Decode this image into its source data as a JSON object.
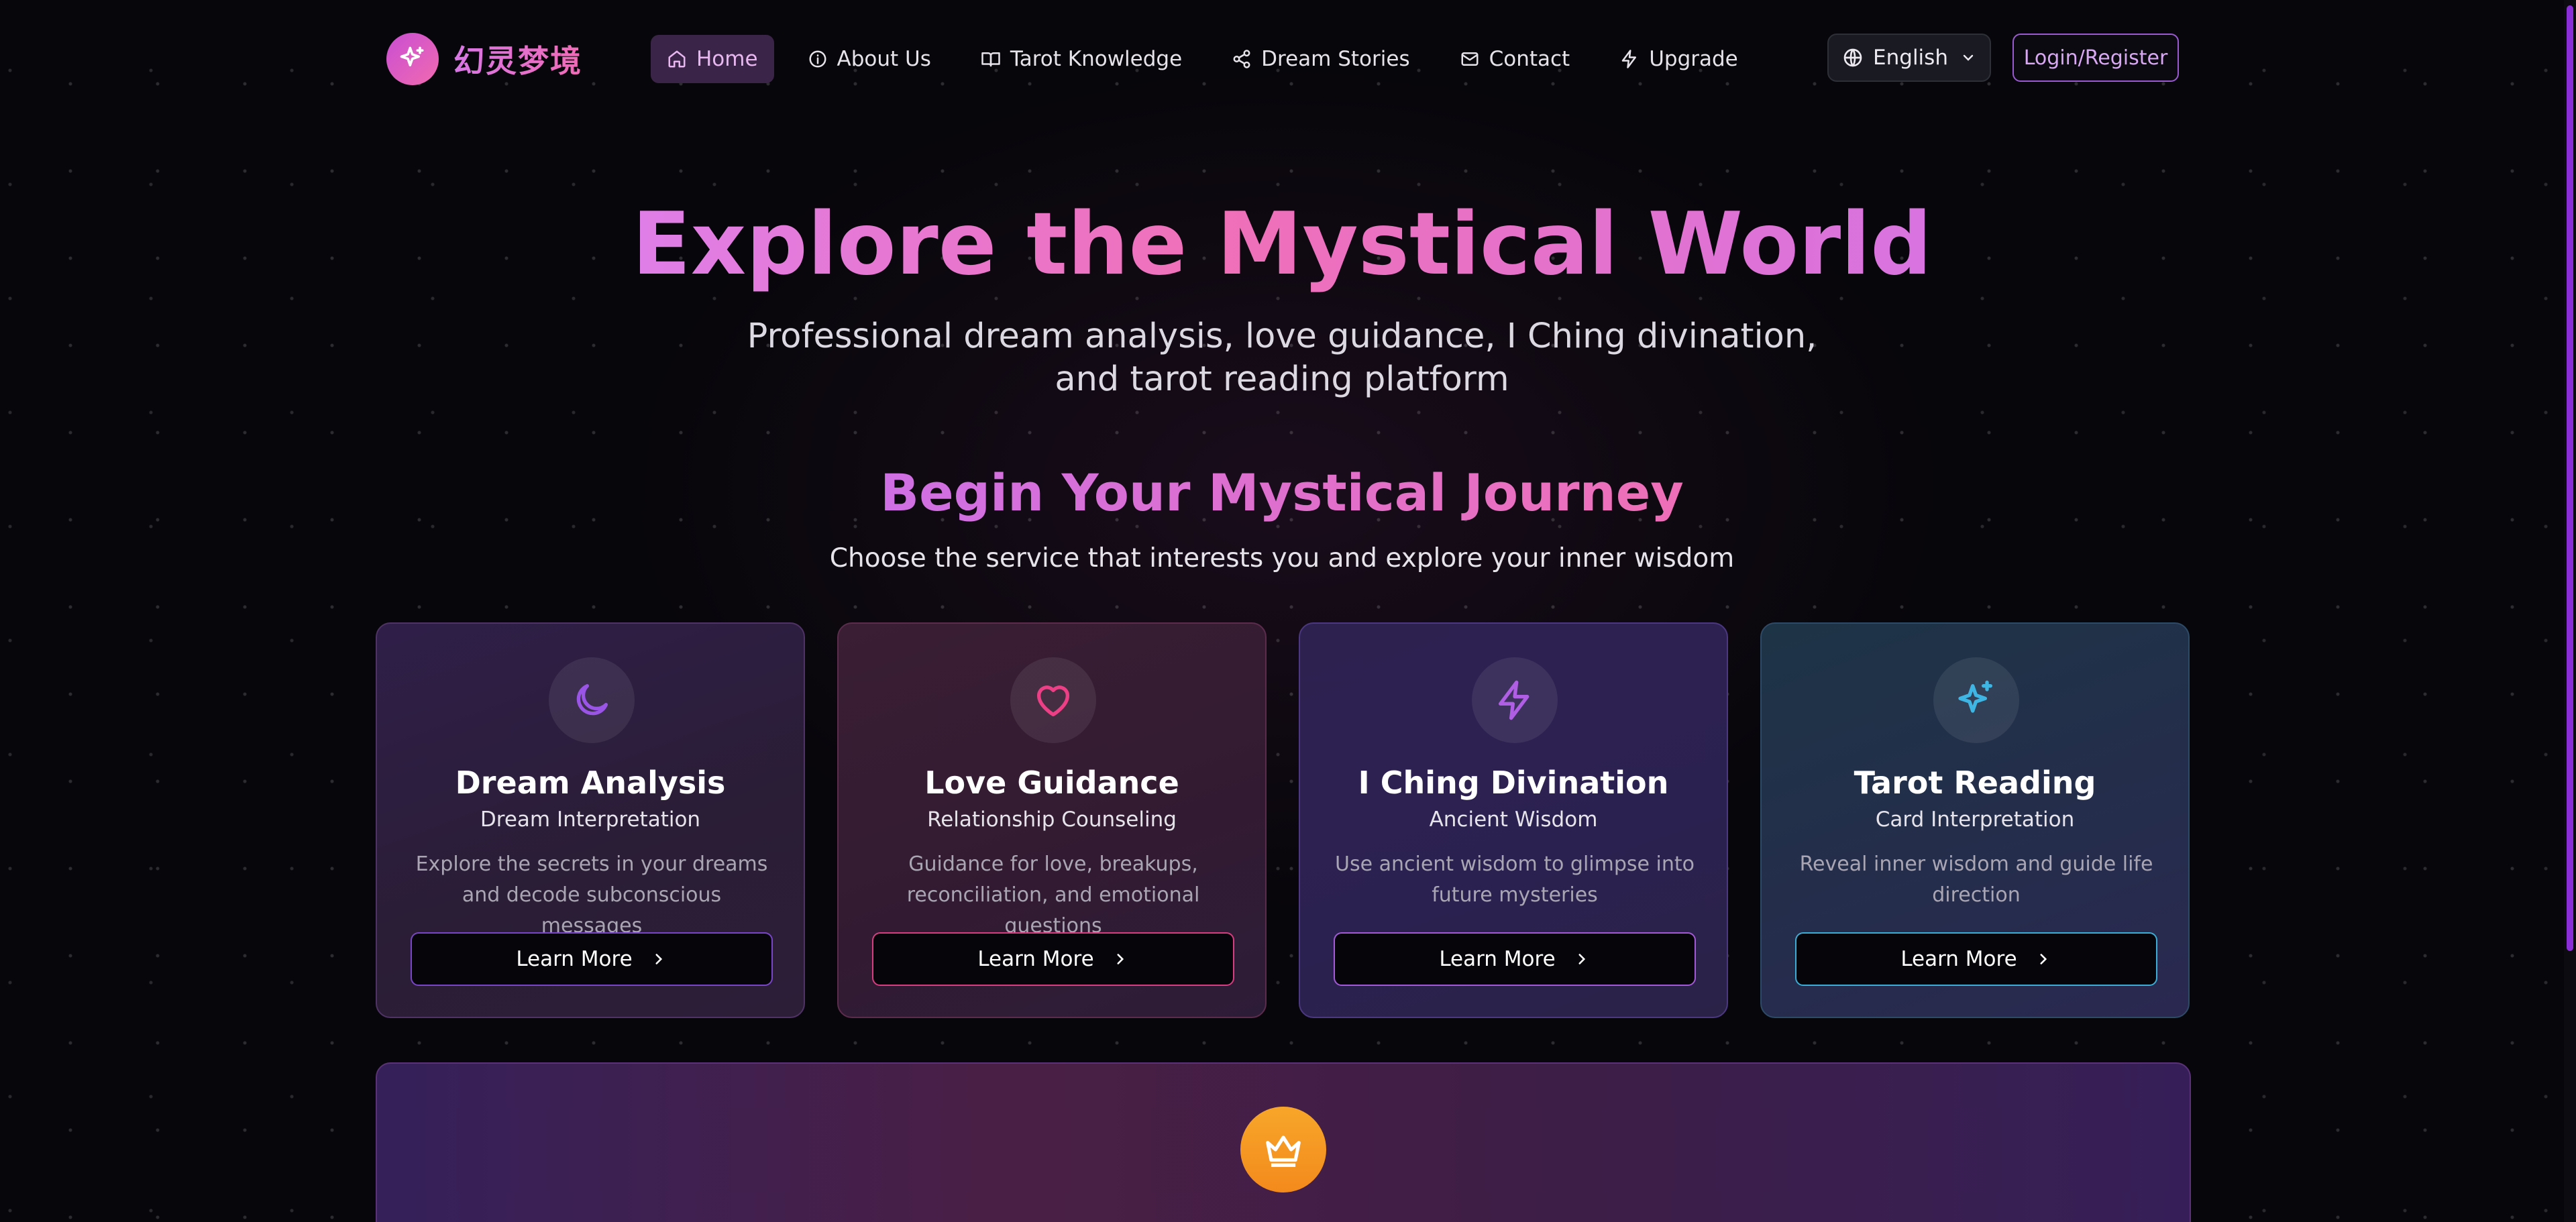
{
  "brand": {
    "name": "幻灵梦境"
  },
  "nav": {
    "items": [
      {
        "label": "Home",
        "icon": "home-icon",
        "active": true
      },
      {
        "label": "About Us",
        "icon": "info-icon",
        "active": false
      },
      {
        "label": "Tarot Knowledge",
        "icon": "book-icon",
        "active": false
      },
      {
        "label": "Dream Stories",
        "icon": "share-icon",
        "active": false
      },
      {
        "label": "Contact",
        "icon": "mail-icon",
        "active": false
      },
      {
        "label": "Upgrade",
        "icon": "lightning-icon",
        "active": false
      }
    ],
    "language": "English",
    "login_label": "Login/Register"
  },
  "hero": {
    "title": "Explore the Mystical World",
    "subtitle": "Professional dream analysis, love guidance, I Ching divination, and tarot reading platform"
  },
  "journey": {
    "title": "Begin Your Mystical Journey",
    "subtitle": "Choose the service that interests you and explore your inner wisdom"
  },
  "cards": [
    {
      "title": "Dream Analysis",
      "subtitle": "Dream Interpretation",
      "description": "Explore the secrets in your dreams and decode subconscious messages",
      "button": "Learn More",
      "icon": "moon-icon",
      "accent": "#9b55e6"
    },
    {
      "title": "Love Guidance",
      "subtitle": "Relationship Counseling",
      "description": "Guidance for love, breakups, reconciliation, and emotional questions",
      "button": "Learn More",
      "icon": "heart-icon",
      "accent": "#ec3f86"
    },
    {
      "title": "I Ching Divination",
      "subtitle": "Ancient Wisdom",
      "description": "Use ancient wisdom to glimpse into future mysteries",
      "button": "Learn More",
      "icon": "lightning-icon",
      "accent": "#b05ee4"
    },
    {
      "title": "Tarot Reading",
      "subtitle": "Card Interpretation",
      "description": "Reveal inner wisdom and guide life direction",
      "button": "Learn More",
      "icon": "sparkles-icon",
      "accent": "#3fb5e4"
    }
  ],
  "premium": {
    "icon": "crown-icon"
  }
}
